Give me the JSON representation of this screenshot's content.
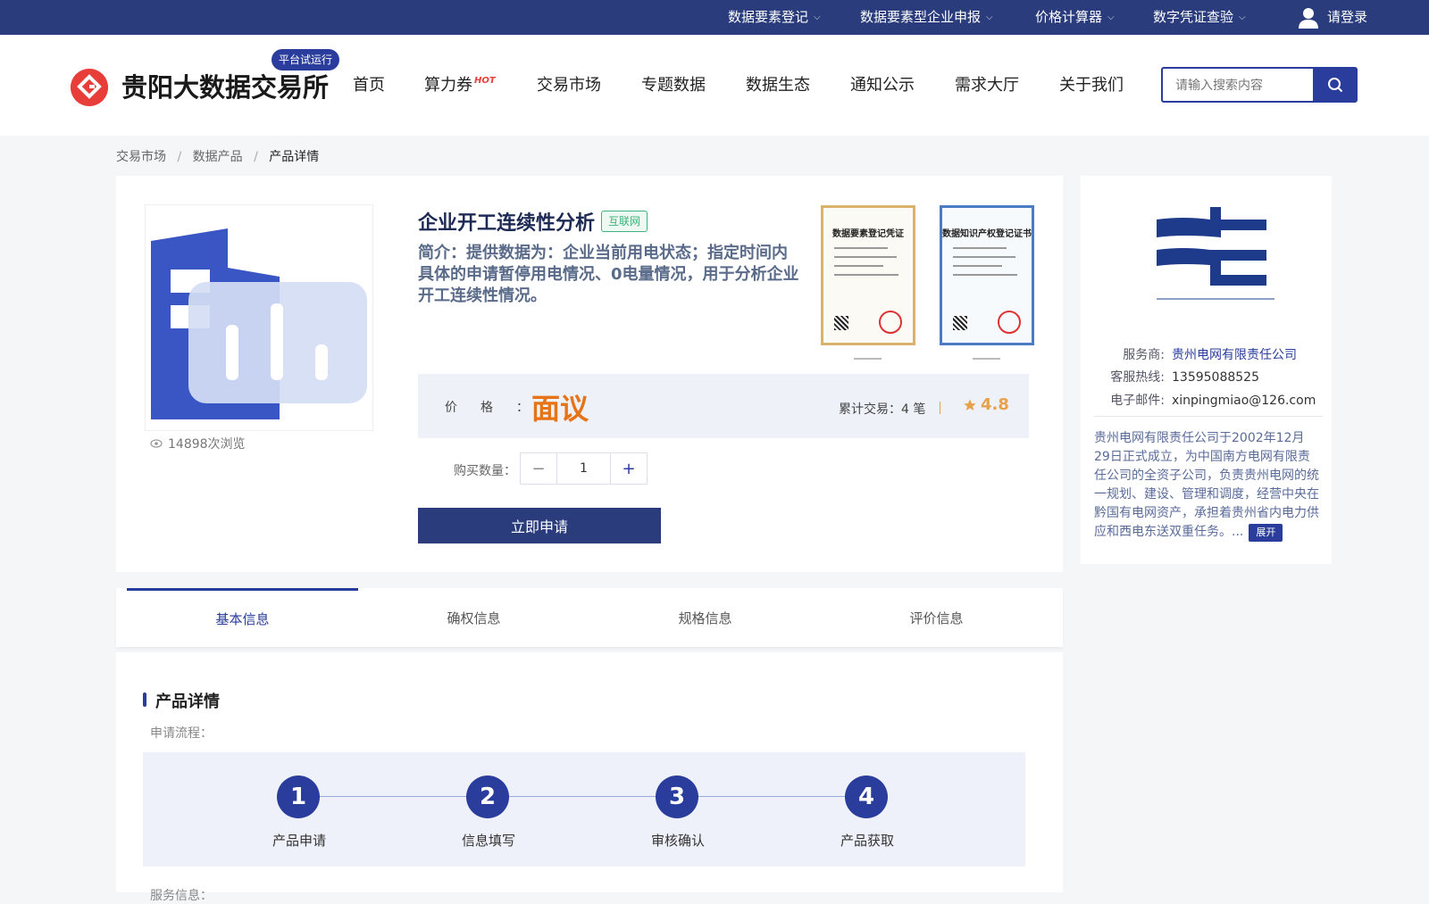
{
  "topbar": {
    "items": [
      {
        "label": "数据要素登记"
      },
      {
        "label": "数据要素型企业申报"
      },
      {
        "label": "价格计算器"
      },
      {
        "label": "数字凭证查验"
      }
    ],
    "login_label": "请登录"
  },
  "header": {
    "site_title": "贵阳大数据交易所",
    "trial_badge": "平台试运行",
    "nav": [
      "首页",
      "算力券",
      "交易市场",
      "专题数据",
      "数据生态",
      "通知公示",
      "需求大厅",
      "关于我们"
    ],
    "hot_tag": "HOT",
    "search_placeholder": "请输入搜索内容"
  },
  "breadcrumb": [
    "交易市场",
    "数据产品",
    "产品详情"
  ],
  "product": {
    "title": "企业开工连续性分析",
    "tag": "互联网",
    "description": "简介：提供数据为：企业当前用电状态；指定时间内具体的申请暂停用电情况、0电量情况，用于分析企业开工连续性情况。",
    "views": "14898次浏览",
    "certificates": [
      "数据要素登记凭证",
      "数据知识产权登记证书"
    ],
    "price_label": "价格：",
    "price": "面议",
    "trades": "累计交易：4 笔",
    "rating": "4.8",
    "qty_label": "购买数量：",
    "qty_value": "1",
    "apply_label": "立即申请"
  },
  "provider": {
    "rows": [
      {
        "key": "服务商:",
        "value": "贵州电网有限责任公司"
      },
      {
        "key": "客服热线:",
        "value": "13595088525"
      },
      {
        "key": "电子邮件:",
        "value": "xinpingmiao@126.com"
      }
    ],
    "description": "贵州电网有限责任公司于2002年12月29日正式成立，为中国南方电网有限责任公司的全资子公司，负责贵州电网的统一规划、建设、管理和调度，经营中央在黔国有电网资产，承担着贵州省内电力供应和西电东送双重任务。...",
    "expand_label": "展开"
  },
  "tabs": [
    "基本信息",
    "确权信息",
    "规格信息",
    "评价信息"
  ],
  "detail": {
    "section_title": "产品详情",
    "flow_label": "申请流程：",
    "steps": [
      {
        "num": "1",
        "label": "产品申请"
      },
      {
        "num": "2",
        "label": "信息填写"
      },
      {
        "num": "3",
        "label": "审核确认"
      },
      {
        "num": "4",
        "label": "产品获取"
      }
    ],
    "service_label": "服务信息："
  },
  "colors": {
    "brand": "#2a3c7c",
    "accent_orange": "#e67316",
    "tag_green": "#3cb37a",
    "logo_red": "#e83e3a"
  }
}
